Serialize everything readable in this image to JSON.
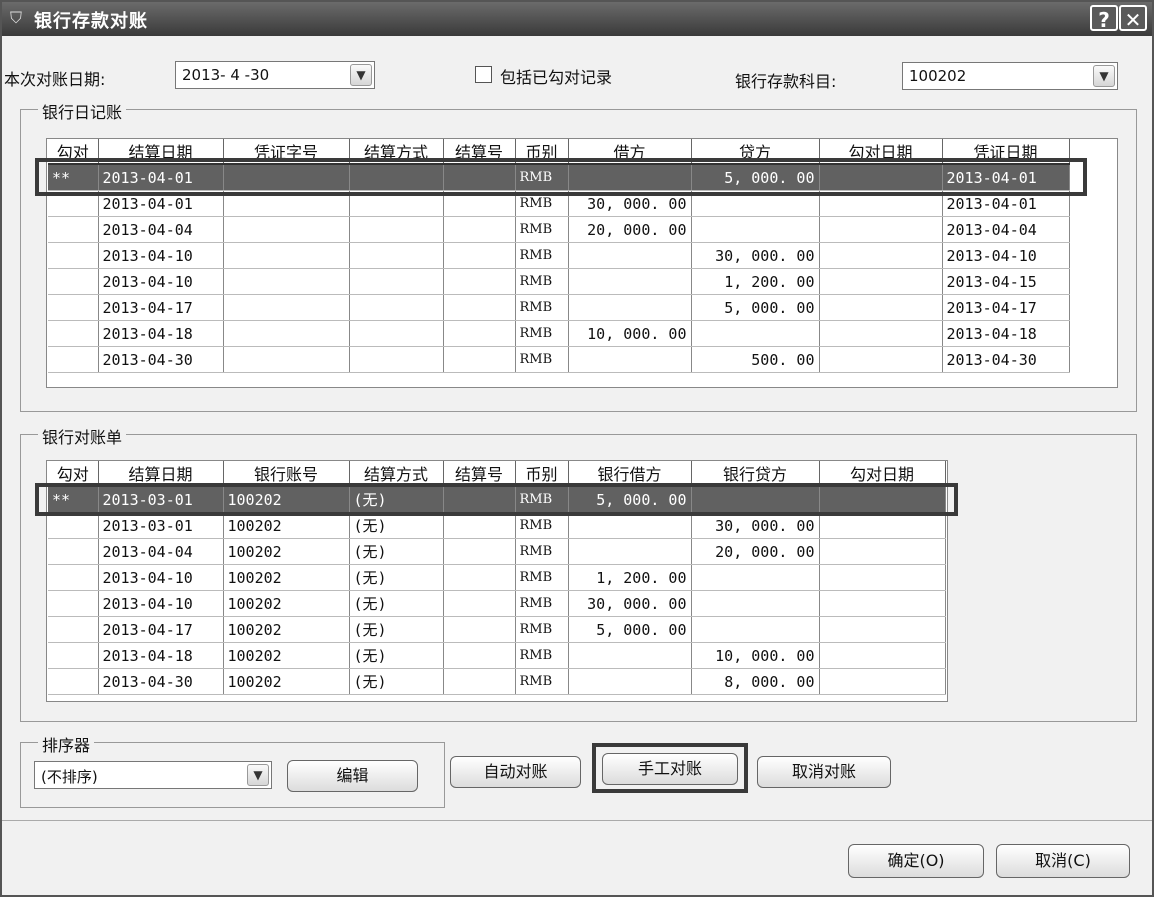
{
  "window": {
    "title": "银行存款对账",
    "help": "?",
    "close": "✕"
  },
  "top": {
    "date_label": "本次对账日期:",
    "date_value": "2013- 4 -30",
    "include_label": "包括已勾对记录",
    "account_label": "银行存款科目:",
    "account_value": "100202"
  },
  "journal": {
    "group_title": "银行日记账",
    "columns": [
      "勾对",
      "结算日期",
      "凭证字号",
      "结算方式",
      "结算号",
      "币别",
      "借方",
      "贷方",
      "勾对日期",
      "凭证日期"
    ],
    "rows": [
      [
        "**",
        "2013-04-01",
        "",
        "",
        "",
        "RMB",
        "",
        "5, 000. 00",
        "",
        "2013-04-01"
      ],
      [
        "",
        "2013-04-01",
        "",
        "",
        "",
        "RMB",
        "30, 000. 00",
        "",
        "",
        "2013-04-01"
      ],
      [
        "",
        "2013-04-04",
        "",
        "",
        "",
        "RMB",
        "20, 000. 00",
        "",
        "",
        "2013-04-04"
      ],
      [
        "",
        "2013-04-10",
        "",
        "",
        "",
        "RMB",
        "",
        "30, 000. 00",
        "",
        "2013-04-10"
      ],
      [
        "",
        "2013-04-10",
        "",
        "",
        "",
        "RMB",
        "",
        "1, 200. 00",
        "",
        "2013-04-15"
      ],
      [
        "",
        "2013-04-17",
        "",
        "",
        "",
        "RMB",
        "",
        "5, 000. 00",
        "",
        "2013-04-17"
      ],
      [
        "",
        "2013-04-18",
        "",
        "",
        "",
        "RMB",
        "10, 000. 00",
        "",
        "",
        "2013-04-18"
      ],
      [
        "",
        "2013-04-30",
        "",
        "",
        "",
        "RMB",
        "",
        "500. 00",
        "",
        "2013-04-30"
      ]
    ]
  },
  "statement": {
    "group_title": "银行对账单",
    "columns": [
      "勾对",
      "结算日期",
      "银行账号",
      "结算方式",
      "结算号",
      "币别",
      "银行借方",
      "银行贷方",
      "勾对日期"
    ],
    "rows": [
      [
        "**",
        "2013-03-01",
        "100202",
        "(无)",
        "",
        "RMB",
        "5, 000. 00",
        "",
        ""
      ],
      [
        "",
        "2013-03-01",
        "100202",
        "(无)",
        "",
        "RMB",
        "",
        "30, 000. 00",
        ""
      ],
      [
        "",
        "2013-04-04",
        "100202",
        "(无)",
        "",
        "RMB",
        "",
        "20, 000. 00",
        ""
      ],
      [
        "",
        "2013-04-10",
        "100202",
        "(无)",
        "",
        "RMB",
        "1, 200. 00",
        "",
        ""
      ],
      [
        "",
        "2013-04-10",
        "100202",
        "(无)",
        "",
        "RMB",
        "30, 000. 00",
        "",
        ""
      ],
      [
        "",
        "2013-04-17",
        "100202",
        "(无)",
        "",
        "RMB",
        "5, 000. 00",
        "",
        ""
      ],
      [
        "",
        "2013-04-18",
        "100202",
        "(无)",
        "",
        "RMB",
        "",
        "10, 000. 00",
        ""
      ],
      [
        "",
        "2013-04-30",
        "100202",
        "(无)",
        "",
        "RMB",
        "",
        "8, 000. 00",
        ""
      ]
    ]
  },
  "sorter": {
    "group_title": "排序器",
    "value": "(不排序)",
    "edit_label": "编辑"
  },
  "actions": {
    "auto": "自动对账",
    "manual": "手工对账",
    "cancel_match": "取消对账"
  },
  "footer": {
    "ok": "确定(O)",
    "cancel": "取消(C)"
  },
  "icons": {
    "title": "shield-icon",
    "dropdown": "chevron-down-icon"
  }
}
